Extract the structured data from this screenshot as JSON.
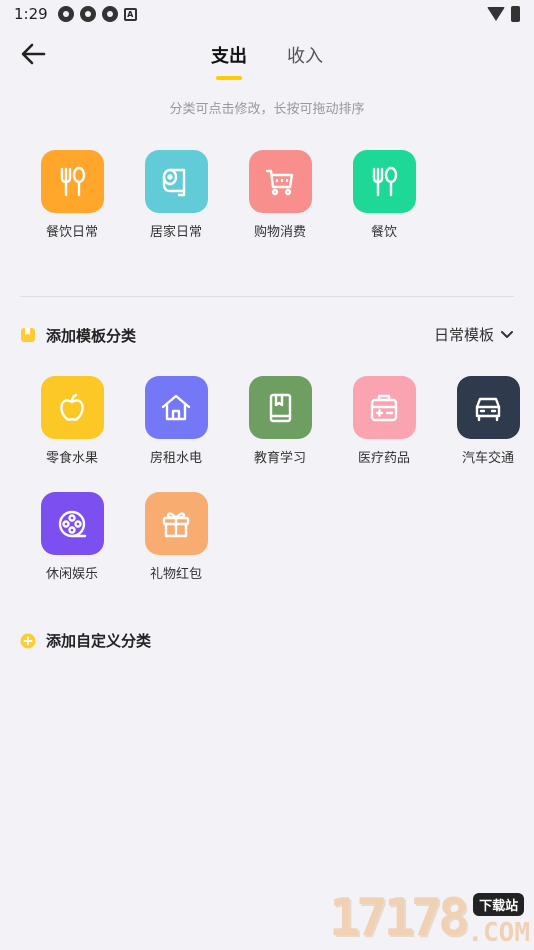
{
  "status_bar": {
    "time": "1:29",
    "a_badge": "A"
  },
  "nav": {
    "tabs": [
      {
        "label": "支出",
        "active": true
      },
      {
        "label": "收入",
        "active": false
      }
    ]
  },
  "hint": "分类可点击修改，长按可拖动排序",
  "current_categories": [
    {
      "label": "餐饮日常",
      "icon": "fork-spoon-icon",
      "color": "#ffa62b"
    },
    {
      "label": "居家日常",
      "icon": "toilet-roll-icon",
      "color": "#62cbd8"
    },
    {
      "label": "购物消费",
      "icon": "shopping-cart-icon",
      "color": "#f88f8c"
    },
    {
      "label": "餐饮",
      "icon": "fork-spoon-icon",
      "color": "#1ed897"
    }
  ],
  "template_section": {
    "title": "添加模板分类",
    "selector_label": "日常模板"
  },
  "template_categories": [
    {
      "label": "零食水果",
      "icon": "apple-icon",
      "color": "#fbc825"
    },
    {
      "label": "房租水电",
      "icon": "house-icon",
      "color": "#7478f6"
    },
    {
      "label": "教育学习",
      "icon": "book-icon",
      "color": "#6e9e62"
    },
    {
      "label": "医疗药品",
      "icon": "medical-kit-icon",
      "color": "#f9a4b0"
    },
    {
      "label": "汽车交通",
      "icon": "car-icon",
      "color": "#2f3a4d"
    },
    {
      "label": "休闲娱乐",
      "icon": "film-reel-icon",
      "color": "#7c4ff0"
    },
    {
      "label": "礼物红包",
      "icon": "gift-icon",
      "color": "#f9ac70"
    }
  ],
  "custom_section": {
    "title": "添加自定义分类"
  },
  "watermark": {
    "number": "17178",
    "tag": "下载站",
    "domain": ".COM"
  }
}
